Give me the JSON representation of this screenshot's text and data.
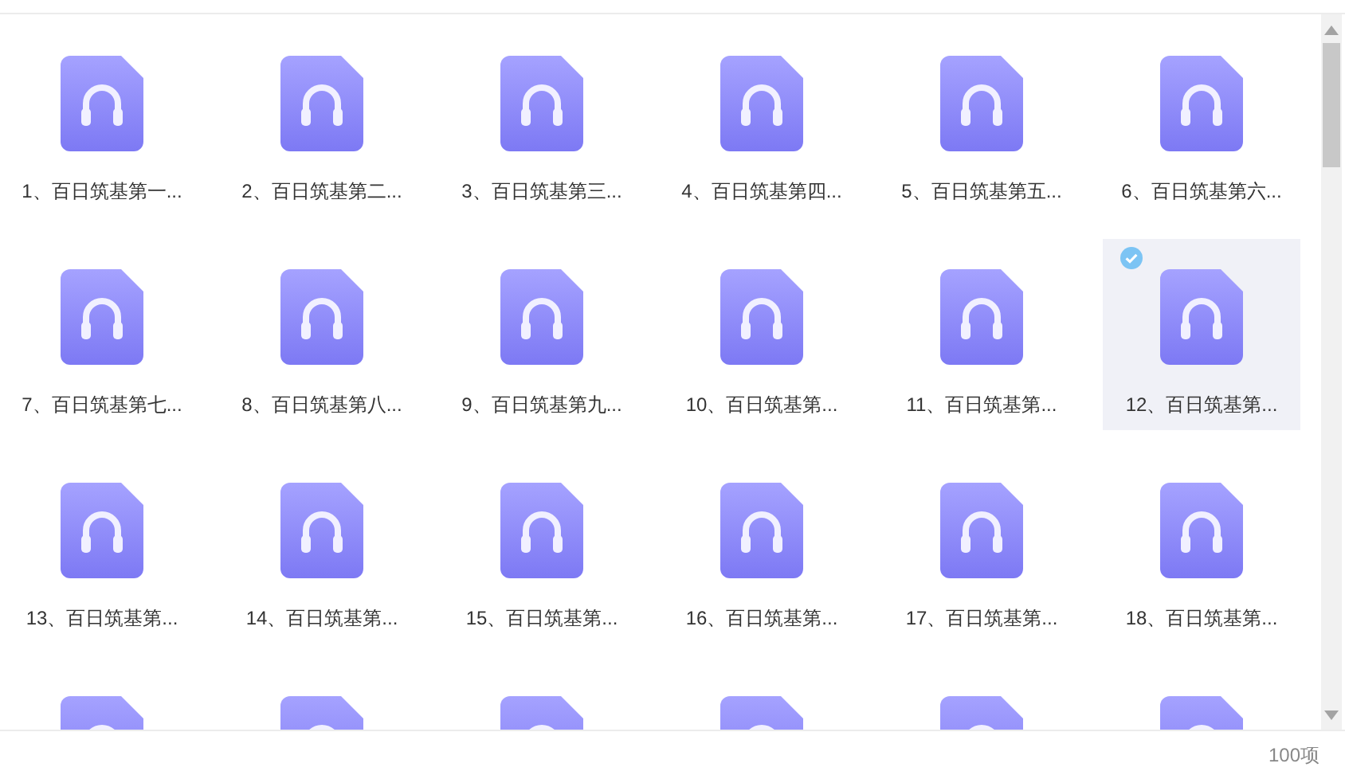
{
  "items": [
    {
      "label": "1、百日筑基第一...",
      "selected": false
    },
    {
      "label": "2、百日筑基第二...",
      "selected": false
    },
    {
      "label": "3、百日筑基第三...",
      "selected": false
    },
    {
      "label": "4、百日筑基第四...",
      "selected": false
    },
    {
      "label": "5、百日筑基第五...",
      "selected": false
    },
    {
      "label": "6、百日筑基第六...",
      "selected": false
    },
    {
      "label": "7、百日筑基第七...",
      "selected": false
    },
    {
      "label": "8、百日筑基第八...",
      "selected": false
    },
    {
      "label": "9、百日筑基第九...",
      "selected": false
    },
    {
      "label": "10、百日筑基第...",
      "selected": false
    },
    {
      "label": "11、百日筑基第...",
      "selected": false
    },
    {
      "label": "12、百日筑基第...",
      "selected": true
    },
    {
      "label": "13、百日筑基第...",
      "selected": false
    },
    {
      "label": "14、百日筑基第...",
      "selected": false
    },
    {
      "label": "15、百日筑基第...",
      "selected": false
    },
    {
      "label": "16、百日筑基第...",
      "selected": false
    },
    {
      "label": "17、百日筑基第...",
      "selected": false
    },
    {
      "label": "18、百日筑基第...",
      "selected": false
    },
    {
      "selected": false
    },
    {
      "selected": false
    },
    {
      "selected": false
    },
    {
      "selected": false
    },
    {
      "selected": false
    },
    {
      "selected": false
    }
  ],
  "status_bar": {
    "count": "100项"
  }
}
